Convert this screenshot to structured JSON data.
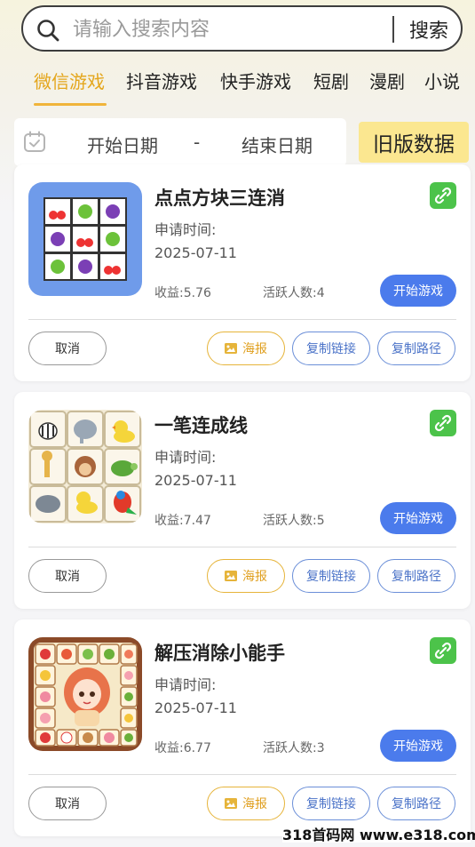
{
  "search": {
    "placeholder": "请输入搜索内容",
    "button_label": "搜索"
  },
  "tabs": [
    {
      "label": "微信游戏",
      "active": true
    },
    {
      "label": "抖音游戏",
      "active": false
    },
    {
      "label": "快手游戏",
      "active": false
    },
    {
      "label": "短剧",
      "active": false
    },
    {
      "label": "漫剧",
      "active": false
    },
    {
      "label": "小说",
      "active": false
    }
  ],
  "date_filter": {
    "start": "开始日期",
    "separator": "-",
    "end": "结束日期"
  },
  "old_data_button": "旧版数据",
  "games": [
    {
      "title": "点点方块三连消",
      "apply_label": "申请时间:",
      "apply_date": "2025-07-11",
      "income": "收益:5.76",
      "active_users": "活跃人数:4",
      "start_label": "开始游戏",
      "cancel_label": "取消",
      "poster_label": "海报",
      "copy_link_label": "复制链接",
      "copy_path_label": "复制路径"
    },
    {
      "title": "一笔连成线",
      "apply_label": "申请时间:",
      "apply_date": "2025-07-11",
      "income": "收益:7.47",
      "active_users": "活跃人数:5",
      "start_label": "开始游戏",
      "cancel_label": "取消",
      "poster_label": "海报",
      "copy_link_label": "复制链接",
      "copy_path_label": "复制路径"
    },
    {
      "title": "解压消除小能手",
      "apply_label": "申请时间:",
      "apply_date": "2025-07-11",
      "income": "收益:6.77",
      "active_users": "活跃人数:3",
      "start_label": "开始游戏",
      "cancel_label": "取消",
      "poster_label": "海报",
      "copy_link_label": "复制链接",
      "copy_path_label": "复制路径"
    }
  ],
  "watermark": "318首码网 www.e318.com",
  "colors": {
    "accent_tab": "#e4a61c",
    "primary_button": "#4b7bec",
    "old_data_bg": "#fbe790",
    "link_icon_bg": "#4cc34a"
  }
}
